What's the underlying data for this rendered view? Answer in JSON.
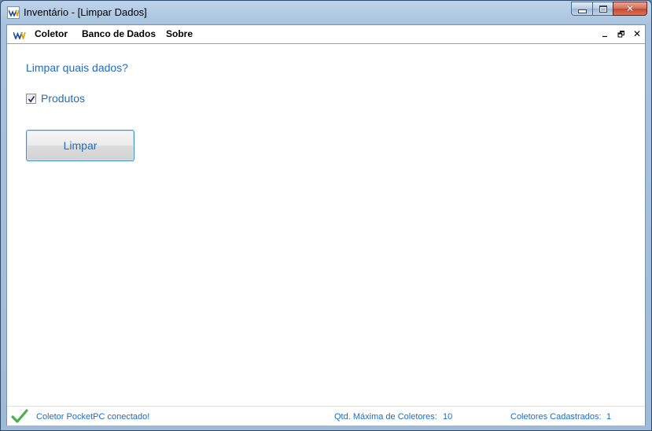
{
  "window": {
    "title": "Inventário - [Limpar Dados]",
    "caption_close": "✕"
  },
  "menu": {
    "items": [
      "Coletor",
      "Banco de Dados",
      "Sobre"
    ],
    "mdi_minimize": "_",
    "mdi_restore": "🗗",
    "mdi_close": "✕"
  },
  "panel": {
    "heading": "Limpar quais dados?",
    "checkbox_label": "Produtos",
    "checkbox_checked": true,
    "clear_button": "Limpar"
  },
  "status": {
    "connection": "Coletor PocketPC conectado!",
    "max_collectors_label": "Qtd. Máxima de Coletores:",
    "max_collectors_value": "10",
    "registered_label": "Coletores Cadastrados:",
    "registered_value": "1"
  },
  "colors": {
    "accent_text": "#1f6cc2",
    "button_border": "#3c8fd6",
    "status_check": "#4caf50"
  }
}
